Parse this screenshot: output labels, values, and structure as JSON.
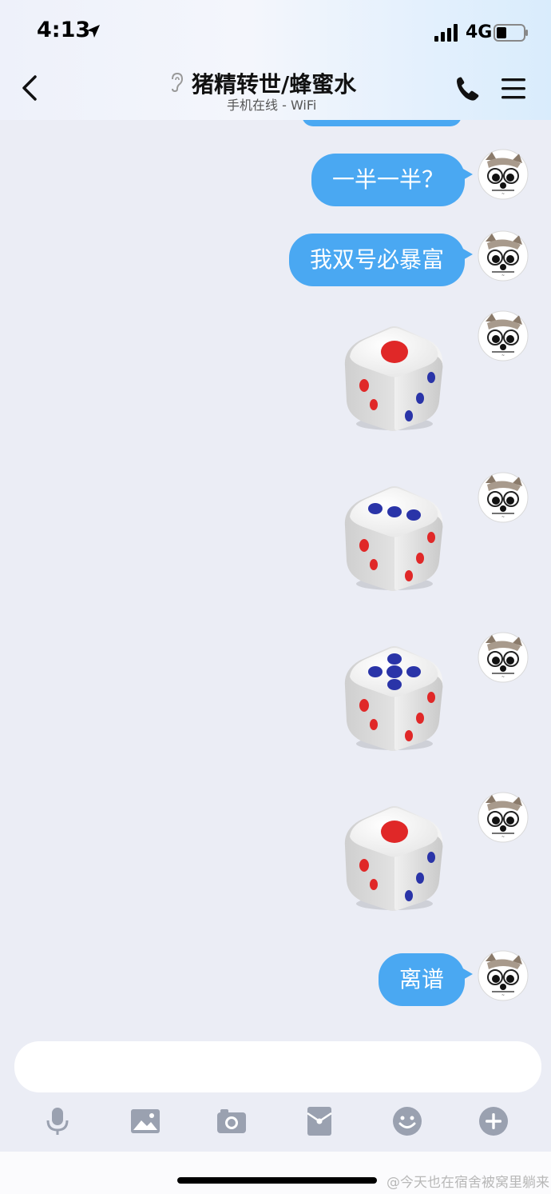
{
  "status_bar": {
    "time": "4:13",
    "network": "4G"
  },
  "header": {
    "title": "猪精转世/蜂蜜水",
    "subtitle": "手机在线 - WiFi"
  },
  "messages": [
    {
      "type": "text",
      "text": "一半一半？"
    },
    {
      "type": "text",
      "text": "我双号必暴富"
    },
    {
      "type": "dice",
      "value": 1
    },
    {
      "type": "dice",
      "value": 3
    },
    {
      "type": "dice",
      "value": 5
    },
    {
      "type": "dice",
      "value": 1
    },
    {
      "type": "text",
      "text": "离谱"
    }
  ],
  "input": {
    "value": "",
    "placeholder": ""
  },
  "toolbar": [
    "microphone-icon",
    "image-icon",
    "camera-icon",
    "red-packet-icon",
    "emoji-icon",
    "plus-icon"
  ],
  "watermark": "@今天也在宿舍被窝里躺来",
  "colors": {
    "bubble": "#4aa8f2",
    "background": "#ebedf5",
    "dice_red": "#e02828",
    "dice_blue": "#2a34a8"
  }
}
